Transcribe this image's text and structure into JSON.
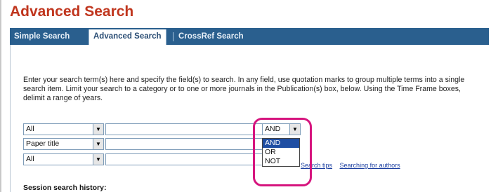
{
  "page": {
    "title": "Advanced Search"
  },
  "tabs": [
    {
      "label": "Simple Search"
    },
    {
      "label": "Advanced Search"
    },
    {
      "label": "CrossRef Search"
    }
  ],
  "instructions": "Enter your search term(s) here and specify the field(s) to search. In any field, use quotation marks to group multiple terms into a single search item. Limit your search to a category or to one or more journals in the Publication(s) box, below. Using the Time Frame boxes, delimit a range of years.",
  "search_rows": [
    {
      "field": "All",
      "term": "",
      "operator": "AND"
    },
    {
      "field": "Paper title",
      "term": ""
    },
    {
      "field": "All",
      "term": ""
    }
  ],
  "operator_dropdown": {
    "options": [
      "AND",
      "OR",
      "NOT"
    ],
    "selected": "AND"
  },
  "links": {
    "search_tips": "Search tips",
    "searching_for_authors": "Searching for authors"
  },
  "history": {
    "label": "Session search history:"
  },
  "colors": {
    "title": "#c0361e",
    "tabbar": "#2a5f8e",
    "highlight": "#d6157e",
    "selected_option": "#1f4ea3"
  }
}
